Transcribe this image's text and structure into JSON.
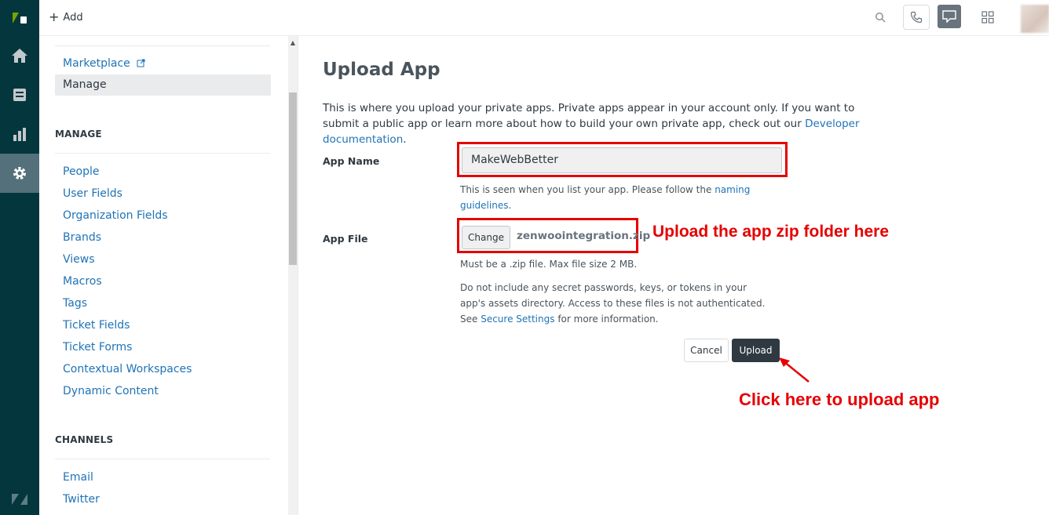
{
  "topbar": {
    "add_label": "Add"
  },
  "sidebar": {
    "marketplace_label": "Marketplace",
    "manage_label": "Manage",
    "manage_heading": "MANAGE",
    "manage_items": [
      {
        "label": "People"
      },
      {
        "label": "User Fields"
      },
      {
        "label": "Organization Fields"
      },
      {
        "label": "Brands"
      },
      {
        "label": "Views"
      },
      {
        "label": "Macros"
      },
      {
        "label": "Tags"
      },
      {
        "label": "Ticket Fields"
      },
      {
        "label": "Ticket Forms"
      },
      {
        "label": "Contextual Workspaces"
      },
      {
        "label": "Dynamic Content"
      }
    ],
    "channels_heading": "CHANNELS",
    "channel_items": [
      {
        "label": "Email"
      },
      {
        "label": "Twitter"
      }
    ]
  },
  "main": {
    "title": "Upload App",
    "intro_text": "This is where you upload your private apps. Private apps appear in your account only. If you want to submit a public app or learn more about how to build your own private app, check out our ",
    "intro_link": "Developer documentation",
    "intro_end": ".",
    "app_name_label": "App Name",
    "app_name_value": "MakeWebBetter",
    "app_name_hint": "This is seen when you list your app. Please follow the ",
    "app_name_hint_link": "naming guidelines",
    "app_name_hint_end": ".",
    "app_file_label": "App File",
    "change_button": "Change",
    "file_name": "zenwoointegration.zip",
    "file_hint": "Must be a .zip file. Max file size 2 MB.",
    "secret_hint": "Do not include any secret passwords, keys, or tokens in your app's assets directory. Access to these files is not authenticated. See ",
    "secret_hint_link": "Secure Settings",
    "secret_hint_end": " for more information.",
    "cancel_button": "Cancel",
    "upload_button": "Upload"
  },
  "annotations": {
    "upload_zip": "Upload the app zip folder here",
    "click_upload": "Click here to upload app",
    "color": "#e60000"
  }
}
